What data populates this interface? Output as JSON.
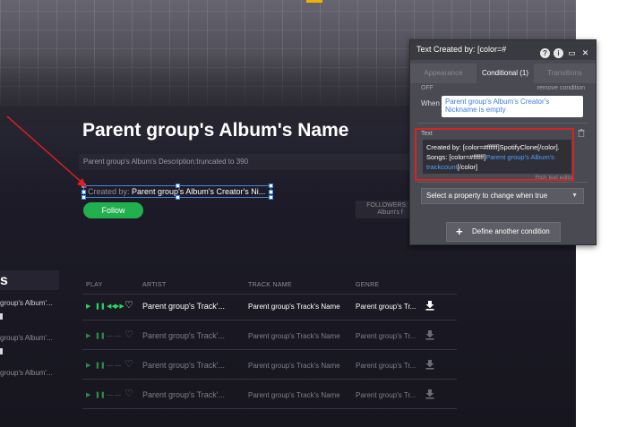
{
  "canvas": {
    "album_title": "Parent group's Album's Name",
    "album_desc": "Parent group's Album's Description:truncated to 390",
    "creator_prefix": "Created by: ",
    "creator_name": "Parent group's Album's Creator's Ni...",
    "follow_label": "Follow",
    "followers_line1": "FOLLOWERS: P",
    "followers_line2": "Album's f",
    "side_heading": "s",
    "side_rows": [
      "group's Album'...",
      "group's Album'...",
      "group's Album'..."
    ],
    "table": {
      "headers": [
        "PLAY",
        "ARTIST",
        "TRACK NAME",
        "GENRE"
      ],
      "rows": [
        {
          "artist": "Parent group's Track'...",
          "track": "Parent group's Track's Name",
          "genre": "Parent group's Tr..."
        },
        {
          "artist": "Parent group's Track'...",
          "track": "Parent group's Track's Name",
          "genre": "Parent group's Tr..."
        },
        {
          "artist": "Parent group's Track'...",
          "track": "Parent group's Track's Name",
          "genre": "Parent group's Tr..."
        },
        {
          "artist": "Parent group's Track'...",
          "track": "Parent group's Track's Name",
          "genre": "Parent group's Tr..."
        }
      ]
    }
  },
  "panel": {
    "title": "Text Created by: [color=#",
    "tabs": {
      "appearance": "Appearance",
      "conditional": "Conditional (1)",
      "transitions": "Transitions"
    },
    "off_label": "OFF",
    "remove_condition": "remove condition",
    "when_label": "When",
    "when_expression": "Parent group's Album's Creator's Nickname is empty",
    "text_label": "Text",
    "text_value_part1": "Created by: [color=#ffffff]SpotifyClone[/color]. Songs: [color=#ffffff]",
    "text_value_link": "Parent group's Album's trackcount",
    "text_value_part2": "[/color]",
    "rich_text_editor": "Rich text editor",
    "select_property": "Select a property to change when true",
    "define_condition": "Define another condition"
  },
  "colors": {
    "accent_green": "#22b04f",
    "selection_blue": "#3f8ae0",
    "highlight_red": "#d52424",
    "link_blue": "#4ea0ff"
  }
}
